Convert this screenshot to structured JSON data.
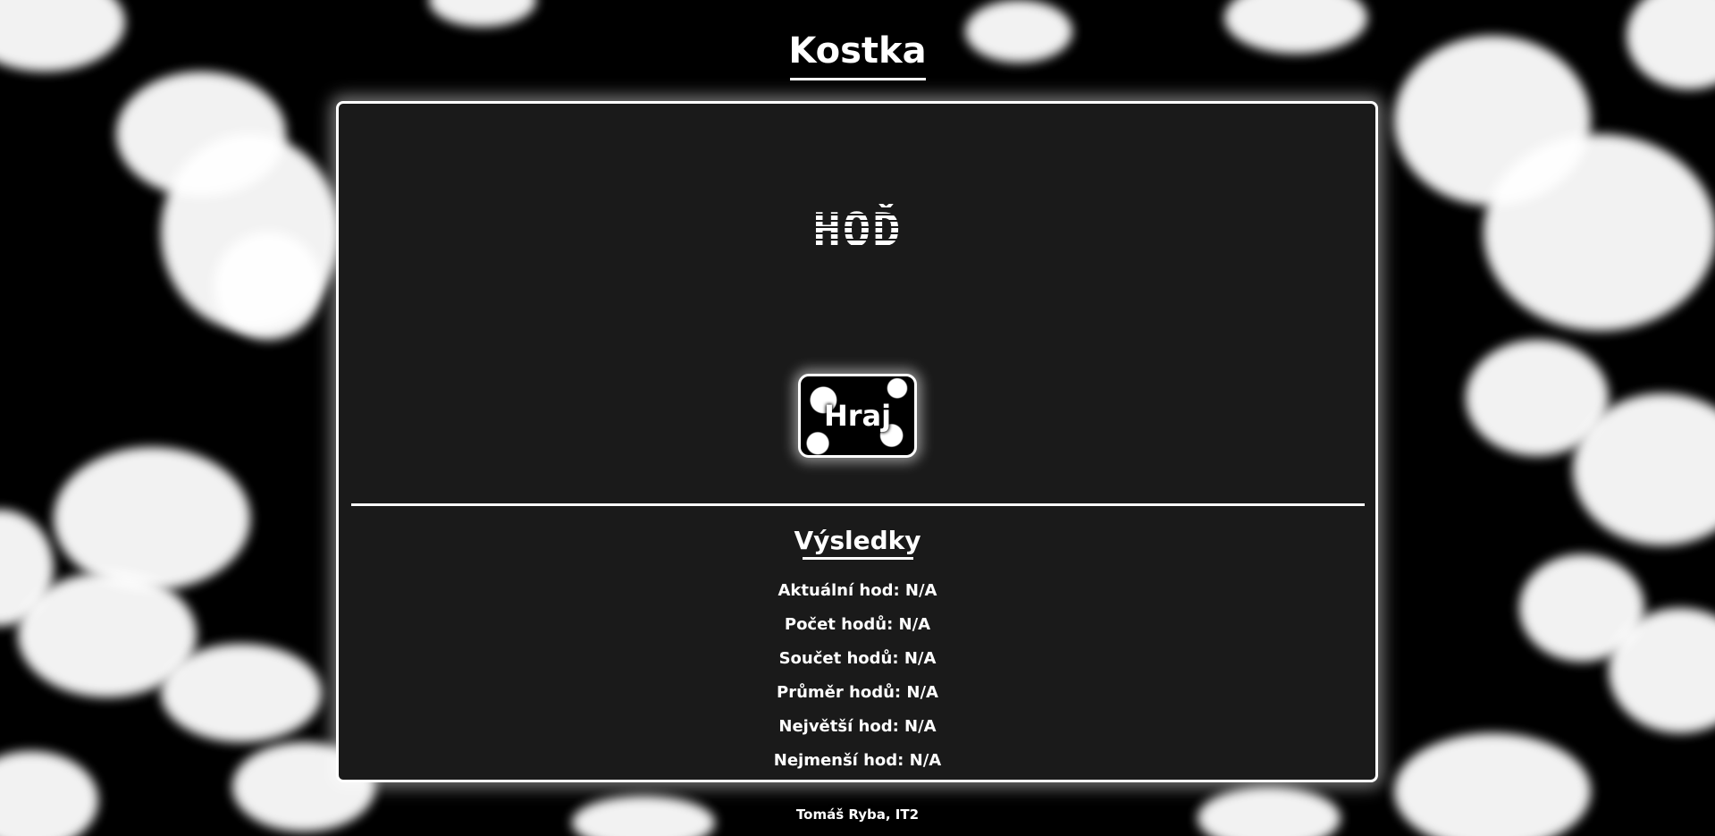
{
  "header": {
    "title": "Kostka"
  },
  "game": {
    "dice_display": "HOĎ",
    "play_button_label": "Hraj"
  },
  "results": {
    "title": "Výsledky",
    "rows": [
      {
        "label": "Aktuální hod: N/A"
      },
      {
        "label": "Počet hodů: N/A"
      },
      {
        "label": "Součet hodů: N/A"
      },
      {
        "label": "Průměr hodů: N/A"
      },
      {
        "label": "Největší hod: N/A"
      },
      {
        "label": "Nejmenší hod: N/A"
      }
    ]
  },
  "footer": {
    "credit": "Tomáš Ryba, IT2"
  },
  "colors": {
    "background": "#000000",
    "panel": "#1a1a1a",
    "accent": "#ffffff"
  }
}
